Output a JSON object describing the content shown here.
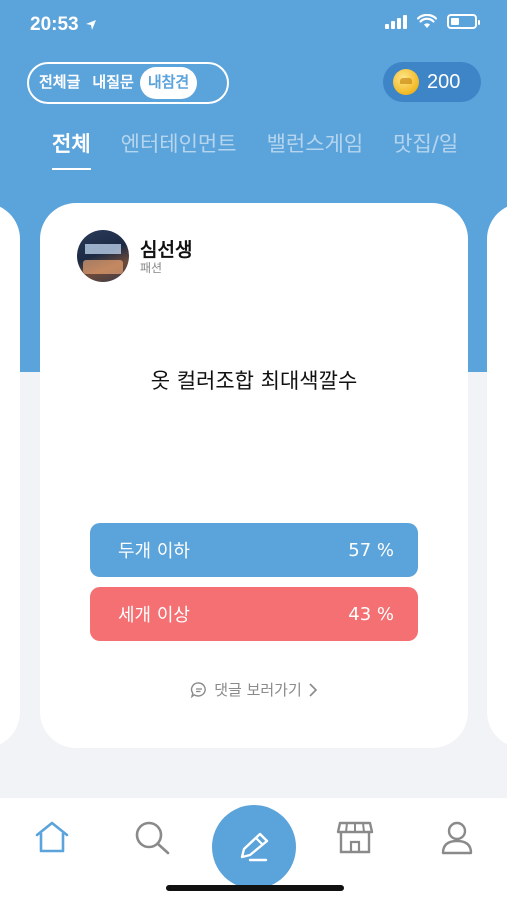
{
  "status_bar": {
    "time": "20:53",
    "battery_level": 0.35
  },
  "header": {
    "filters": [
      {
        "label": "전체글",
        "active": false
      },
      {
        "label": "내질문",
        "active": false
      },
      {
        "label": "내참견",
        "active": true
      }
    ],
    "coins": {
      "count": "200",
      "icon": "coin-icon"
    }
  },
  "tabs": [
    {
      "label": "전체",
      "active": true
    },
    {
      "label": "엔터테인먼트",
      "active": false
    },
    {
      "label": "밸런스게임",
      "active": false
    },
    {
      "label": "맛집/일",
      "active": false
    }
  ],
  "card": {
    "author": {
      "name": "심선생",
      "category": "패션"
    },
    "question": "옷 컬러조합 최대색깔수",
    "options": [
      {
        "label": "두개 이하",
        "percent": "57 %",
        "color": "#5ba3db"
      },
      {
        "label": "세개 이상",
        "percent": "43 %",
        "color": "#f47073"
      }
    ],
    "comments_link": "댓글 보러가기"
  },
  "bottom_nav": {
    "items": [
      "home-icon",
      "search-icon",
      "pencil-icon",
      "store-icon",
      "profile-icon"
    ]
  },
  "colors": {
    "accent": "#5ba3db",
    "danger": "#f47073",
    "background": "#f2f3f7"
  }
}
